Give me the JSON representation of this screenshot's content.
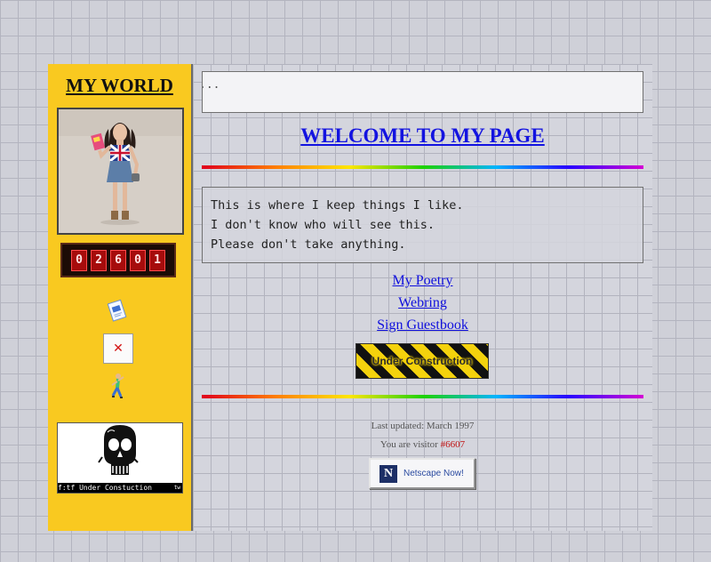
{
  "sidebar": {
    "title": "MY WORLD",
    "counter_digits": [
      "0",
      "2",
      "6",
      "0",
      "1"
    ],
    "broken_image_glyph": "✕",
    "banner_caption": "f:tf Under Constuction",
    "banner_tag": "tw"
  },
  "main": {
    "marquee_text": "...",
    "welcome_heading": "WELCOME TO MY PAGE",
    "intro_lines": [
      "This is where I keep things I like.",
      "I don't know who will see this.",
      "Please don't take anything."
    ],
    "links": [
      "My Poetry",
      "Webring",
      "Sign Guestbook"
    ],
    "construction_label": "Under Construction",
    "footer": {
      "last_updated": "Last updated: March 1997",
      "visitor_prefix": "You are visitor ",
      "visitor_count": "#6607"
    },
    "netscape_badge": {
      "letter": "N",
      "label": "Netscape Now!"
    }
  },
  "colors": {
    "sidebar_bg": "#f9c920",
    "link": "#1010dd",
    "heading": "#1313e0",
    "counter_bg": "#a60c0c"
  },
  "icons": [
    "mail-icon",
    "broken-image-icon",
    "dancing-figure-icon",
    "skull-icon"
  ]
}
